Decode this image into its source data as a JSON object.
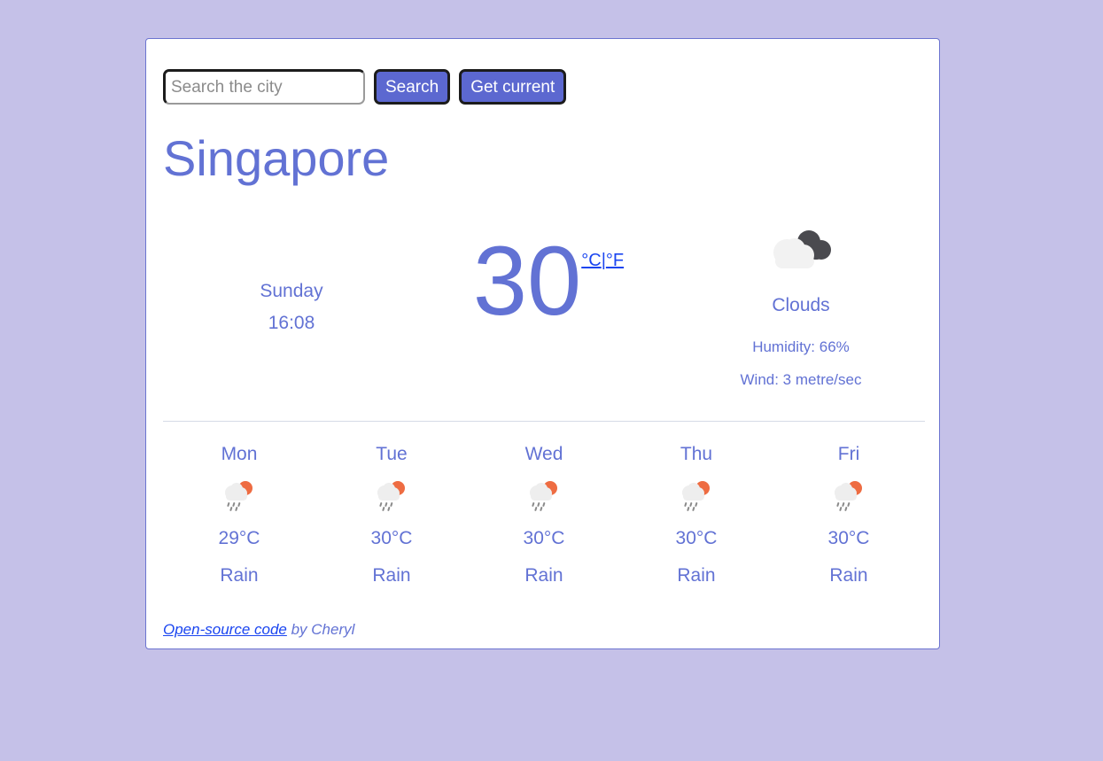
{
  "page": {
    "background_color": "#c5c1e8",
    "card_border_color": "#6c74d0",
    "accent_color": "#6272d4",
    "link_color": "#1a45f0",
    "button_color": "#5c68d0"
  },
  "search": {
    "placeholder": "Search the city",
    "value": "",
    "search_button_label": "Search",
    "geolocate_button_label": "Get current"
  },
  "city": {
    "name": "Singapore"
  },
  "current": {
    "day_of_week": "Sunday",
    "time": "16:08",
    "temperature": "30",
    "unit_celsius_label": "°C",
    "unit_separator": "|",
    "unit_fahrenheit_label": "°F",
    "condition": "Clouds",
    "condition_icon": "clouds-icon",
    "humidity": "Humidity: 66%",
    "wind": "Wind: 3 metre/sec"
  },
  "forecast": {
    "days": [
      {
        "name": "Mon",
        "icon": "rain-sun-icon",
        "temperature": "29°C",
        "condition": "Rain"
      },
      {
        "name": "Tue",
        "icon": "rain-sun-icon",
        "temperature": "30°C",
        "condition": "Rain"
      },
      {
        "name": "Wed",
        "icon": "rain-sun-icon",
        "temperature": "30°C",
        "condition": "Rain"
      },
      {
        "name": "Thu",
        "icon": "rain-sun-icon",
        "temperature": "30°C",
        "condition": "Rain"
      },
      {
        "name": "Fri",
        "icon": "rain-sun-icon",
        "temperature": "30°C",
        "condition": "Rain"
      }
    ]
  },
  "footer": {
    "link_label": "Open-source code",
    "credit": " by Cheryl"
  }
}
